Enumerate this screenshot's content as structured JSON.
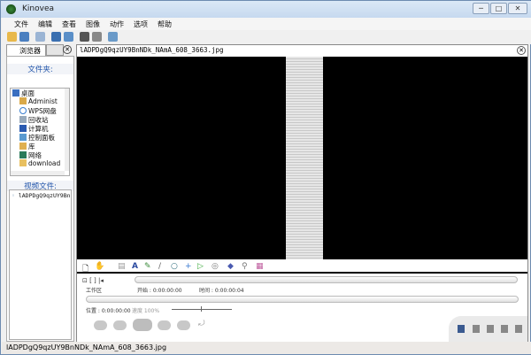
{
  "window": {
    "title": "Kinovea",
    "minimize": "─",
    "maximize": "□",
    "close": "✕"
  },
  "menu": [
    "文件",
    "编辑",
    "查看",
    "图像",
    "动作",
    "选项",
    "帮助"
  ],
  "left": {
    "tab_browser": "浏览器",
    "folders_label": "文件夹:",
    "tree": [
      "桌面",
      "Administ",
      "WPS网盘",
      "回收站",
      "计算机",
      "控制面板",
      "库",
      "网络",
      "download"
    ],
    "videos_label": "视频文件:",
    "files": [
      "lADPDgQ9qzUY9Bn"
    ]
  },
  "main": {
    "filename": "lADPDgQ9qzUY9BnNDk_NAmA_608_3663.jpg",
    "controls": {
      "workspace": "工作区",
      "start": "开始 : 0:00:00:00",
      "duration": "时间 : 0:00:00:04",
      "position": "位置 : 0:00:00:00",
      "speed": "速度 100%"
    }
  },
  "status": "lADPDgQ9qzUY9BnNDk_NAmA_608_3663.jpg"
}
